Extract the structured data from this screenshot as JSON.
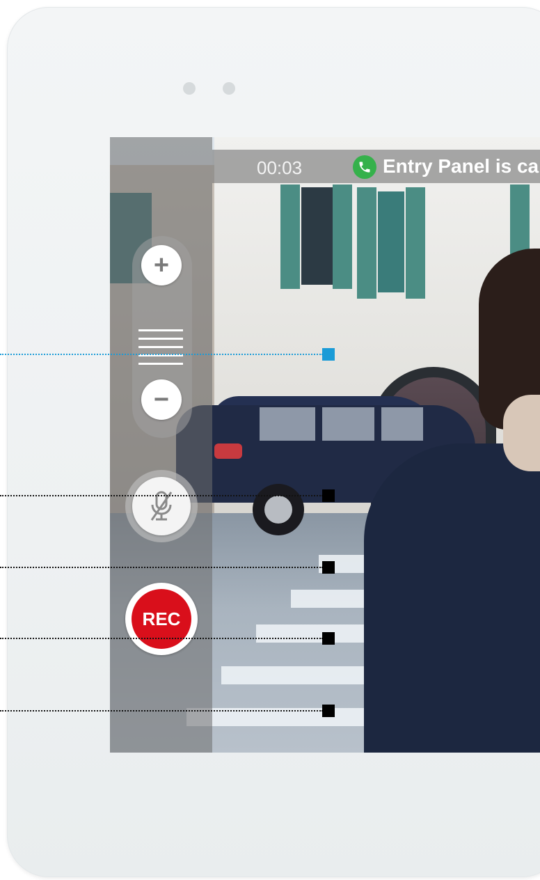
{
  "call": {
    "timer": "00:03",
    "status": "Entry Panel is call"
  },
  "controls": {
    "zoom_in_symbol": "+",
    "zoom_out_symbol": "−",
    "mute_icon": "microphone-muted-icon",
    "record_label": "REC"
  },
  "colors": {
    "record": "#d90f1b",
    "call_green": "#35b14b",
    "callout_blue": "#1a9bd7",
    "callout_black": "#000000"
  },
  "callouts": [
    {
      "target": "zoom-slider",
      "color": "blue"
    },
    {
      "target": "mute-button",
      "color": "black"
    },
    {
      "target": "mute-button-lower",
      "color": "black"
    },
    {
      "target": "record-button",
      "color": "black"
    },
    {
      "target": "record-button-lower",
      "color": "black"
    }
  ]
}
